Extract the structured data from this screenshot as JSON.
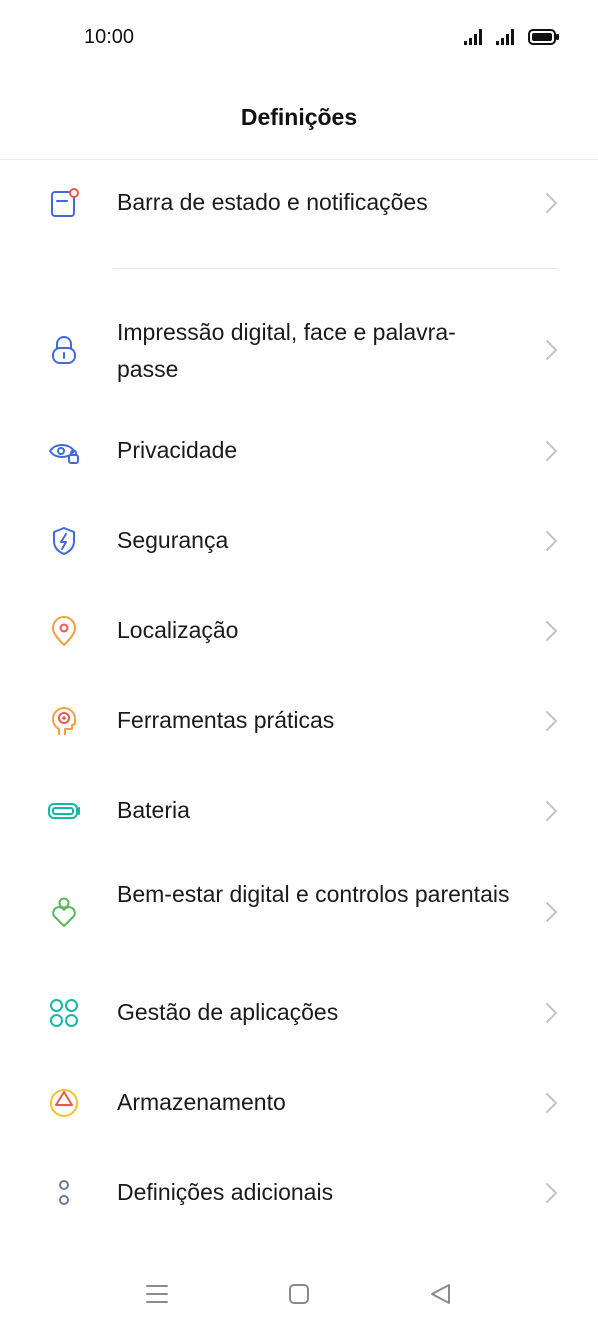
{
  "status_bar": {
    "time": "10:00",
    "icons": [
      "signal-icon",
      "signal-icon",
      "battery-icon"
    ]
  },
  "header": {
    "title": "Definições"
  },
  "settings": {
    "items": [
      {
        "label": "Barra de estado e notificações",
        "icon": "notification-bar-icon"
      },
      {
        "label": "Impressão digital, face e palavra-passe",
        "icon": "lock-icon"
      },
      {
        "label": "Privacidade",
        "icon": "privacy-eye-icon"
      },
      {
        "label": "Segurança",
        "icon": "security-shield-icon"
      },
      {
        "label": "Localização",
        "icon": "location-pin-icon"
      },
      {
        "label": "Ferramentas práticas",
        "icon": "tools-head-icon"
      },
      {
        "label": "Bateria",
        "icon": "battery-icon"
      },
      {
        "label": "Bem-estar digital e controlos parentais",
        "icon": "digital-wellbeing-icon"
      },
      {
        "label": "Gestão de aplicações",
        "icon": "app-management-icon"
      },
      {
        "label": "Armazenamento",
        "icon": "storage-icon"
      },
      {
        "label": "Definições adicionais",
        "icon": "additional-settings-icon"
      }
    ]
  },
  "colors": {
    "blue": "#3f6ad8",
    "orange": "#f0a142",
    "red": "#e85a4f",
    "teal": "#17b6a8",
    "green": "#5cb85c",
    "yellow": "#f5c12e",
    "gray_blue": "#6a7c9a",
    "chevron": "#c4c4c4"
  },
  "navbar": {
    "buttons": [
      "menu-icon",
      "home-icon",
      "back-icon"
    ]
  }
}
